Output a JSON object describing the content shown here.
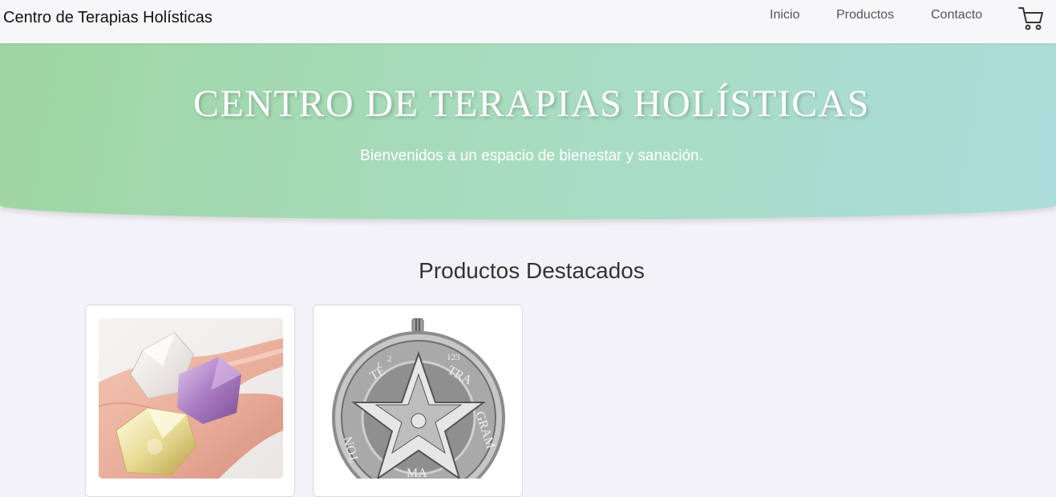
{
  "navbar": {
    "brand": "Centro de Terapias Holísticas",
    "links": [
      {
        "label": "Inicio"
      },
      {
        "label": "Productos"
      },
      {
        "label": "Contacto"
      }
    ],
    "cart_icon": "shopping-cart-icon"
  },
  "hero": {
    "title": "CENTRO DE TERAPIAS HOLÍSTICAS",
    "subtitle": "Bienvenidos a un espacio de bienestar y sanación."
  },
  "products": {
    "section_title": "Productos Destacados",
    "items": [
      {
        "image": "crystals-in-hand-image"
      },
      {
        "image": "tetragrammaton-pendant-image"
      }
    ]
  },
  "pendant_text": {
    "te": "TE",
    "tra": "TRA",
    "gram": "GRAM",
    "ton": "TON",
    "ma": "MA",
    "n1": "1",
    "n2": "2",
    "n123": "123"
  }
}
